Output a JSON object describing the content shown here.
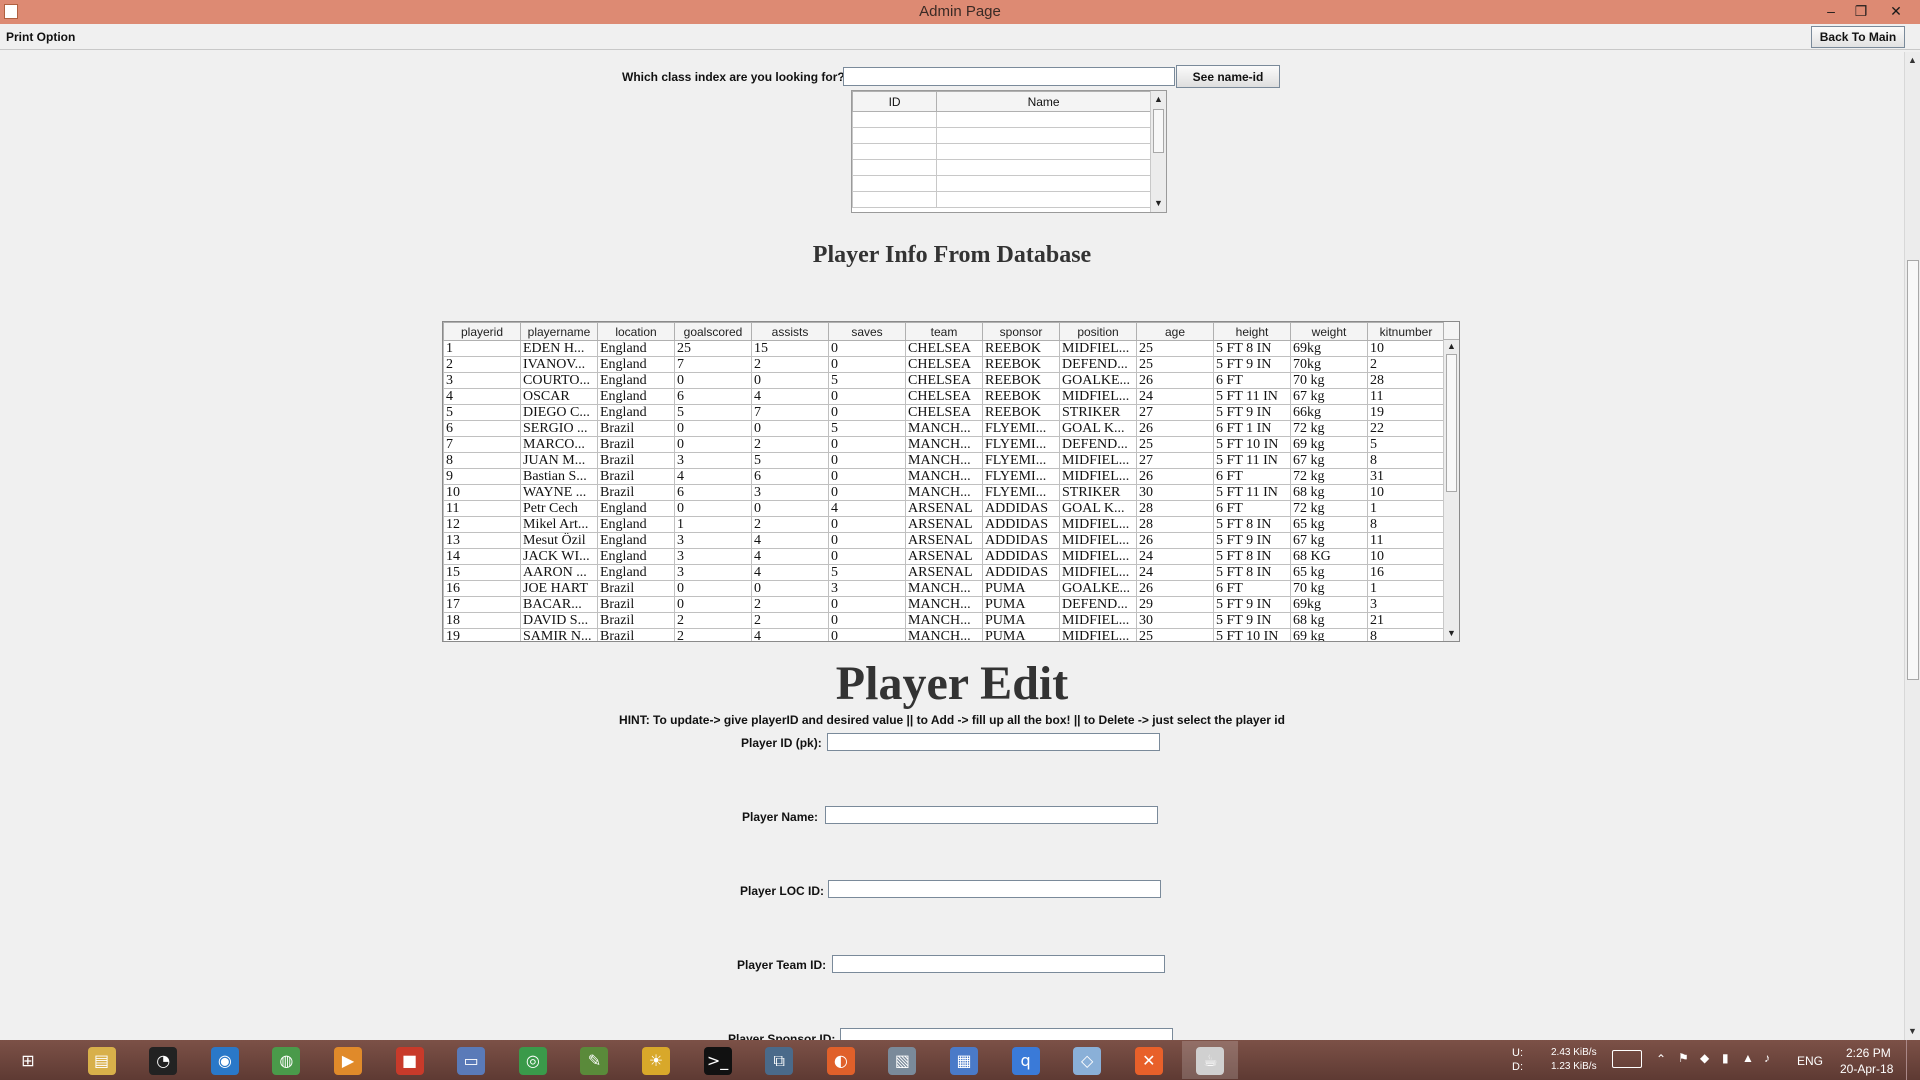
{
  "window": {
    "title": "Admin Page",
    "minimize": "–",
    "restore": "❐",
    "close": "✕"
  },
  "menubar": {
    "print_option": "Print Option",
    "back_to_main": "Back To Main"
  },
  "class_search": {
    "label": "Which class index are you looking for?",
    "input_value": "",
    "button": "See name-id",
    "table_headers": [
      "ID",
      "Name"
    ]
  },
  "player_info_title": "Player Info From Database",
  "player_table": {
    "headers": [
      "playerid",
      "playername",
      "location",
      "goalscored",
      "assists",
      "saves",
      "team",
      "sponsor",
      "position",
      "age",
      "height",
      "weight",
      "kitnumber"
    ],
    "rows": [
      [
        "1",
        "EDEN H...",
        "England",
        "25",
        "15",
        "0",
        "CHELSEA",
        "REEBOK",
        "MIDFIEL...",
        "25",
        "5 FT 8 IN",
        "69kg",
        "10"
      ],
      [
        "2",
        "IVANOV...",
        "England",
        "7",
        "2",
        "0",
        "CHELSEA",
        "REEBOK",
        "DEFEND...",
        "25",
        "5 FT 9 IN",
        "70kg",
        "2"
      ],
      [
        "3",
        "COURTO...",
        "England",
        "0",
        "0",
        "5",
        "CHELSEA",
        "REEBOK",
        "GOALKE...",
        "26",
        "6 FT",
        "70 kg",
        "28"
      ],
      [
        "4",
        "OSCAR",
        "England",
        "6",
        "4",
        "0",
        "CHELSEA",
        "REEBOK",
        "MIDFIEL...",
        "24",
        "5 FT 11 IN",
        "67 kg",
        "11"
      ],
      [
        "5",
        "DIEGO C...",
        "England",
        "5",
        "7",
        "0",
        "CHELSEA",
        "REEBOK",
        "STRIKER",
        "27",
        "5 FT 9 IN",
        "66kg",
        "19"
      ],
      [
        "6",
        "SERGIO ...",
        "Brazil",
        "0",
        "0",
        "5",
        "MANCH...",
        "FLYEMI...",
        "GOAL K...",
        "26",
        "6 FT 1 IN",
        "72 kg",
        "22"
      ],
      [
        "7",
        "MARCO...",
        "Brazil",
        "0",
        "2",
        "0",
        "MANCH...",
        "FLYEMI...",
        "DEFEND...",
        "25",
        "5 FT 10 IN",
        "69 kg",
        "5"
      ],
      [
        "8",
        "JUAN M...",
        "Brazil",
        "3",
        "5",
        "0",
        "MANCH...",
        "FLYEMI...",
        "MIDFIEL...",
        "27",
        "5 FT 11 IN",
        "67 kg",
        "8"
      ],
      [
        "9",
        "Bastian S...",
        "Brazil",
        "4",
        "6",
        "0",
        "MANCH...",
        "FLYEMI...",
        "MIDFIEL...",
        "26",
        "6 FT",
        "72 kg",
        "31"
      ],
      [
        "10",
        "WAYNE ...",
        "Brazil",
        "6",
        "3",
        "0",
        "MANCH...",
        "FLYEMI...",
        "STRIKER",
        "30",
        "5 FT 11 IN",
        "68 kg",
        "10"
      ],
      [
        "11",
        "Petr Cech",
        "England",
        "0",
        "0",
        "4",
        "ARSENAL",
        "ADDIDAS",
        "GOAL K...",
        "28",
        "6 FT",
        "72 kg",
        "1"
      ],
      [
        "12",
        "Mikel Art...",
        "England",
        "1",
        "2",
        "0",
        "ARSENAL",
        "ADDIDAS",
        "MIDFIEL...",
        "28",
        "5 FT 8 IN",
        "65 kg",
        "8"
      ],
      [
        "13",
        "Mesut Özil",
        "England",
        "3",
        "4",
        "0",
        "ARSENAL",
        "ADDIDAS",
        "MIDFIEL...",
        "26",
        "5 FT 9 IN",
        "67 kg",
        "11"
      ],
      [
        "14",
        "JACK WI...",
        "England",
        "3",
        "4",
        "0",
        "ARSENAL",
        "ADDIDAS",
        "MIDFIEL...",
        "24",
        "5 FT 8 IN",
        "68 KG",
        "10"
      ],
      [
        "15",
        "AARON ...",
        "England",
        "3",
        "4",
        "5",
        "ARSENAL",
        "ADDIDAS",
        "MIDFIEL...",
        "24",
        "5 FT 8 IN",
        "65 kg",
        "16"
      ],
      [
        "16",
        "JOE HART",
        "Brazil",
        "0",
        "0",
        "3",
        "MANCH...",
        "PUMA",
        "GOALKE...",
        "26",
        "6 FT",
        "70 kg",
        "1"
      ],
      [
        "17",
        "BACAR...",
        "Brazil",
        "0",
        "2",
        "0",
        "MANCH...",
        "PUMA",
        "DEFEND...",
        "29",
        "5 FT 9 IN",
        "69kg",
        "3"
      ],
      [
        "18",
        "DAVID S...",
        "Brazil",
        "2",
        "2",
        "0",
        "MANCH...",
        "PUMA",
        "MIDFIEL...",
        "30",
        "5 FT 9 IN",
        "68 kg",
        "21"
      ],
      [
        "19",
        "SAMIR N...",
        "Brazil",
        "2",
        "4",
        "0",
        "MANCH...",
        "PUMA",
        "MIDFIEL...",
        "25",
        "5 FT 10 IN",
        "69 kg",
        "8"
      ]
    ]
  },
  "player_edit": {
    "title": "Player Edit",
    "hint": "HINT: To update-> give playerID and desired value || to Add -> fill up all the box! || to Delete -> just select the player id",
    "fields": [
      {
        "label": "Player ID (pk):",
        "value": ""
      },
      {
        "label": "Player Name:",
        "value": ""
      },
      {
        "label": "Player LOC ID:",
        "value": ""
      },
      {
        "label": "Player Team ID:",
        "value": ""
      },
      {
        "label": "Player Sponsor ID:",
        "value": ""
      }
    ]
  },
  "taskbar": {
    "apps": [
      "windows-start-icon",
      "file-explorer-icon",
      "speedometer-icon",
      "globe-icon",
      "earth-icon",
      "media-player-icon",
      "office-icon",
      "screen-icon",
      "chrome-icon",
      "notepad-icon",
      "lightbulb-icon",
      "terminal-icon",
      "network-icon",
      "firefox-icon",
      "image-viewer-icon",
      "control-panel-icon",
      "qbittorrent-icon",
      "box-icon",
      "xampp-icon",
      "java-icon"
    ],
    "net_up_label": "U:",
    "net_down_label": "D:",
    "net_up": "2.43 KiB/s",
    "net_down": "1.23 KiB/s",
    "language": "ENG",
    "time": "2:26 PM",
    "date": "20-Apr-18"
  }
}
